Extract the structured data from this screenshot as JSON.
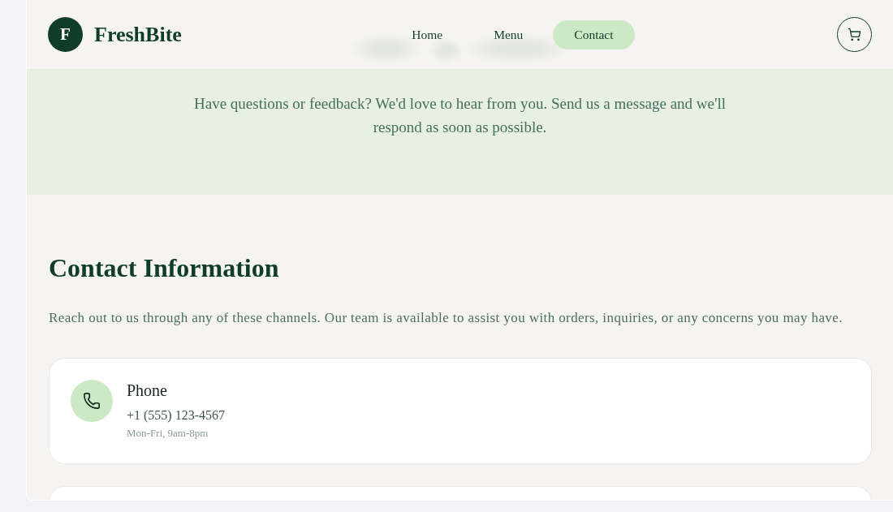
{
  "header": {
    "logo": {
      "mark": "F",
      "name": "FreshBite"
    },
    "nav": [
      {
        "label": "Home",
        "selected": false
      },
      {
        "label": "Menu",
        "selected": false
      },
      {
        "label": "Contact",
        "selected": true
      }
    ]
  },
  "hero": {
    "text": "Have questions or feedback? We'd love to hear from you. Send us a message and we'll respond as soon as possible."
  },
  "contact": {
    "title": "Contact Information",
    "intro": "Reach out to us through any of these channels. Our team is available to assist you with orders, inquiries, or any concerns you may have.",
    "cards": [
      {
        "kind": "phone",
        "title": "Phone",
        "value": "+1 (555) 123-4567",
        "note": "Mon-Fri, 9am-8pm"
      }
    ]
  }
}
